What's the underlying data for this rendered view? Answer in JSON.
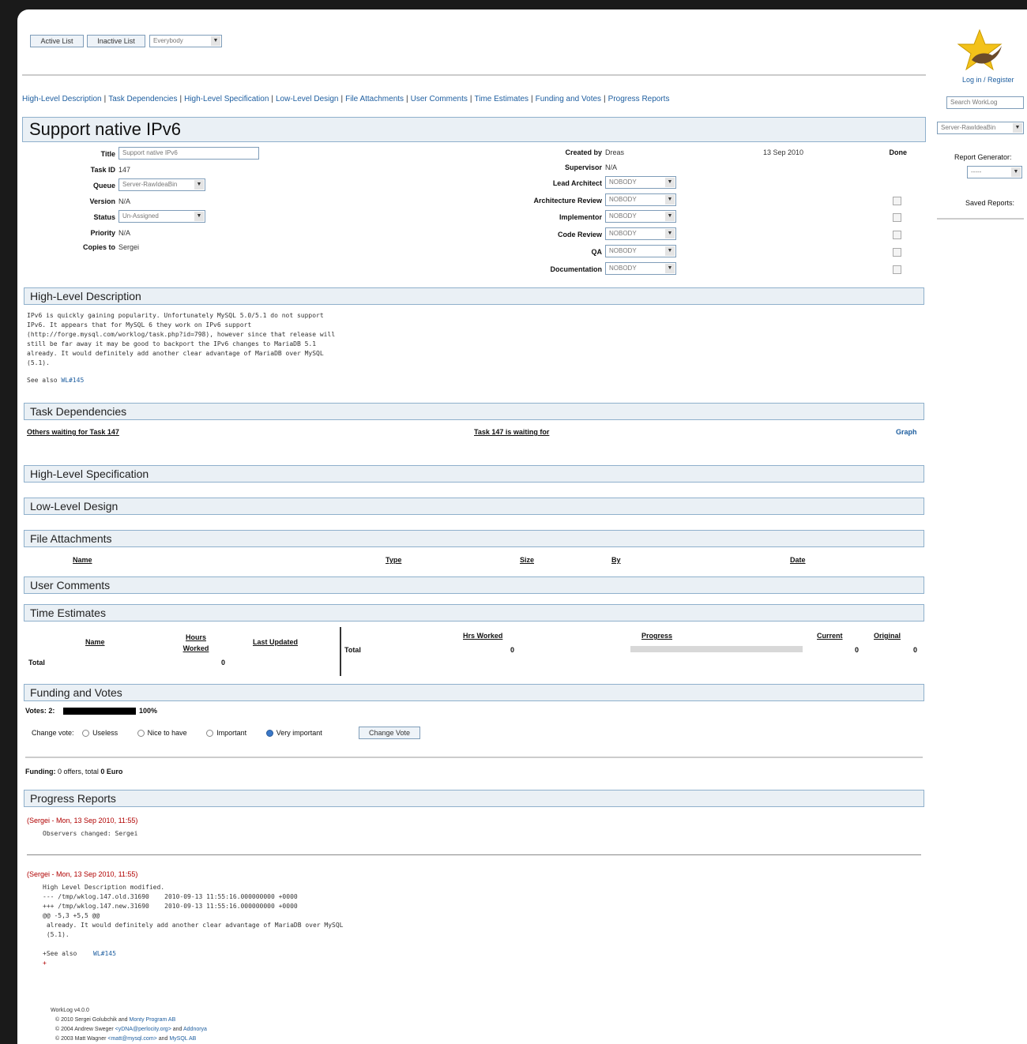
{
  "toolbar": {
    "active_list": "Active List",
    "inactive_list": "Inactive List",
    "filter_select": "Everybody"
  },
  "right": {
    "login": "Log in / Register",
    "search_placeholder": "Search WorkLog",
    "queue_select": "Server-RawIdeaBin",
    "report_generator_label": "Report Generator:",
    "report_select": "-----",
    "saved_reports_label": "Saved Reports:"
  },
  "nav": [
    "High-Level Description",
    "Task Dependencies",
    "High-Level Specification",
    "Low-Level Design",
    "File Attachments",
    "User Comments",
    "Time Estimates",
    "Funding and Votes",
    "Progress Reports"
  ],
  "task": {
    "heading": "Support native IPv6",
    "title_label": "Title",
    "title_value": "Support native IPv6",
    "taskid_label": "Task ID",
    "taskid_value": "147",
    "queue_label": "Queue",
    "queue_value": "Server-RawIdeaBin",
    "version_label": "Version",
    "version_value": "N/A",
    "status_label": "Status",
    "status_value": "Un-Assigned",
    "priority_label": "Priority",
    "priority_value": "N/A",
    "copies_label": "Copies to",
    "copies_value": "Sergei",
    "created_label": "Created by",
    "created_value": "Dreas",
    "created_date": "13 Sep 2010",
    "done_label": "Done",
    "supervisor_label": "Supervisor",
    "supervisor_value": "N/A",
    "roles": [
      {
        "label": "Lead Architect",
        "value": "NOBODY"
      },
      {
        "label": "Architecture Review",
        "value": "NOBODY"
      },
      {
        "label": "Implementor",
        "value": "NOBODY"
      },
      {
        "label": "Code Review",
        "value": "NOBODY"
      },
      {
        "label": "QA",
        "value": "NOBODY"
      },
      {
        "label": "Documentation",
        "value": "NOBODY"
      }
    ]
  },
  "sections": {
    "hld": "High-Level Description",
    "deps": "Task Dependencies",
    "hls": "High-Level Specification",
    "lld": "Low-Level Design",
    "files": "File Attachments",
    "comments": "User Comments",
    "time": "Time Estimates",
    "funding": "Funding and Votes",
    "progress": "Progress Reports"
  },
  "hld": {
    "text": "IPv6 is quickly gaining popularity. Unfortunately MySQL 5.0/5.1 do not support\nIPv6. It appears that for MySQL 6 they work on IPv6 support\n(http://forge.mysql.com/worklog/task.php?id=798), however since that release will\nstill be far away it may be good to backport the IPv6 changes to MariaDB 5.1\nalready. It would definitely add another clear advantage of MariaDB over MySQL\n(5.1).",
    "see_also": "See also",
    "see_also_link": "WL#145"
  },
  "deps": {
    "others": "Others waiting for Task 147",
    "waiting": "Task 147 is waiting for",
    "graph": "Graph"
  },
  "files": {
    "cols": [
      "Name",
      "Type",
      "Size",
      "By",
      "Date"
    ]
  },
  "time": {
    "name": "Name",
    "hours": "Hours Worked",
    "last": "Last Updated",
    "total": "Total",
    "total_hours": "0",
    "hrs_worked": "Hrs Worked",
    "progress": "Progress",
    "current": "Current",
    "original": "Original",
    "total2": "Total",
    "hrs_val": "0",
    "progress_fraction": 0.0,
    "current_val": "0",
    "original_val": "0"
  },
  "funding": {
    "votes_label": "Votes: 2:",
    "votes_pct": "100%",
    "votes_fraction": 1.0,
    "change_vote": "Change vote:",
    "options": [
      "Useless",
      "Nice to have",
      "Important",
      "Very important"
    ],
    "selected": 3,
    "change_button": "Change Vote",
    "funding_label": "Funding:",
    "funding_text": "0 offers, total",
    "funding_total": "0 Euro"
  },
  "reports": [
    {
      "header": "(Sergei - Mon, 13 Sep 2010, 11:55)",
      "body": "Observers changed: Sergei"
    },
    {
      "header": "(Sergei - Mon, 13 Sep 2010, 11:55)",
      "body": "High Level Description modified.\n--- /tmp/wklog.147.old.31690    2010-09-13 11:55:16.000000000 +0000\n+++ /tmp/wklog.147.new.31690    2010-09-13 11:55:16.000000000 +0000\n@@ -5,3 +5,5 @@\n already. It would definitely add another clear advantage of MariaDB over MySQL\n (5.1).\n\n+See also",
      "link": "WL#145",
      "tail": "+"
    }
  ],
  "footer": {
    "version": "WorkLog v4.0.0",
    "line1_a": "© 2010  Sergei Golubchik and",
    "line1_link": "Monty Program AB",
    "line2_a": "© 2004  Andrew Sweger",
    "line2_link": "<yDNA@perlocity.org>",
    "line2_b": "and",
    "line2_link2": "Addnorya",
    "line3_a": "© 2003  Matt Wagner",
    "line3_link": "<matt@mysql.com>",
    "line3_b": "and",
    "line3_link2": "MySQL AB"
  },
  "colors": {
    "accent": "#1f5fa0",
    "section_bg": "#eaf0f5",
    "section_border": "#8fb0cc",
    "report_header": "#b00000"
  }
}
